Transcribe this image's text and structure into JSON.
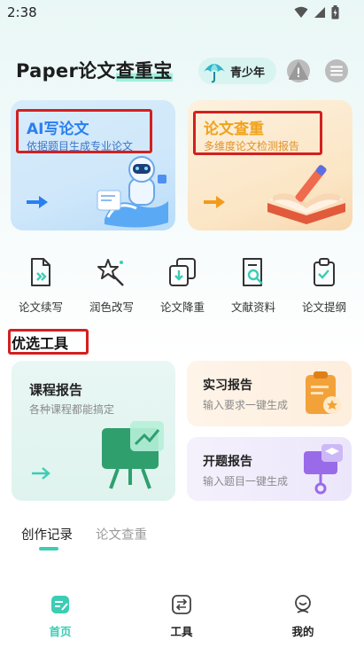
{
  "status": {
    "time": "2:38"
  },
  "header": {
    "title_prefix": "Paper论文",
    "title_highlight": "查重宝",
    "teen_label": "青少年",
    "alert_glyph": "!"
  },
  "cards": {
    "ai": {
      "title": "AI写论文",
      "subtitle": "依据题目生成专业论文"
    },
    "check": {
      "title": "论文查重",
      "subtitle": "多维度论文检测报告"
    }
  },
  "tools": [
    {
      "label": "论文续写",
      "icon": "doc-continue-icon"
    },
    {
      "label": "润色改写",
      "icon": "polish-icon"
    },
    {
      "label": "论文降重",
      "icon": "reduce-icon"
    },
    {
      "label": "文献资料",
      "icon": "literature-icon"
    },
    {
      "label": "论文提纲",
      "icon": "outline-icon"
    }
  ],
  "section": {
    "title": "优选工具"
  },
  "tool_cards": {
    "course": {
      "title": "课程报告",
      "subtitle": "各种课程都能搞定"
    },
    "intern": {
      "title": "实习报告",
      "subtitle": "输入要求一键生成"
    },
    "open": {
      "title": "开题报告",
      "subtitle": "输入题目一键生成"
    }
  },
  "records": {
    "tabs": [
      "创作记录",
      "论文查重"
    ],
    "active_index": 0
  },
  "bottom_nav": {
    "items": [
      "首页",
      "工具",
      "我的"
    ],
    "active_index": 0
  },
  "colors": {
    "accent": "#3ccdb4",
    "blue": "#2a7ff0",
    "orange": "#f0a21a",
    "annotation_red": "#d3201f"
  }
}
